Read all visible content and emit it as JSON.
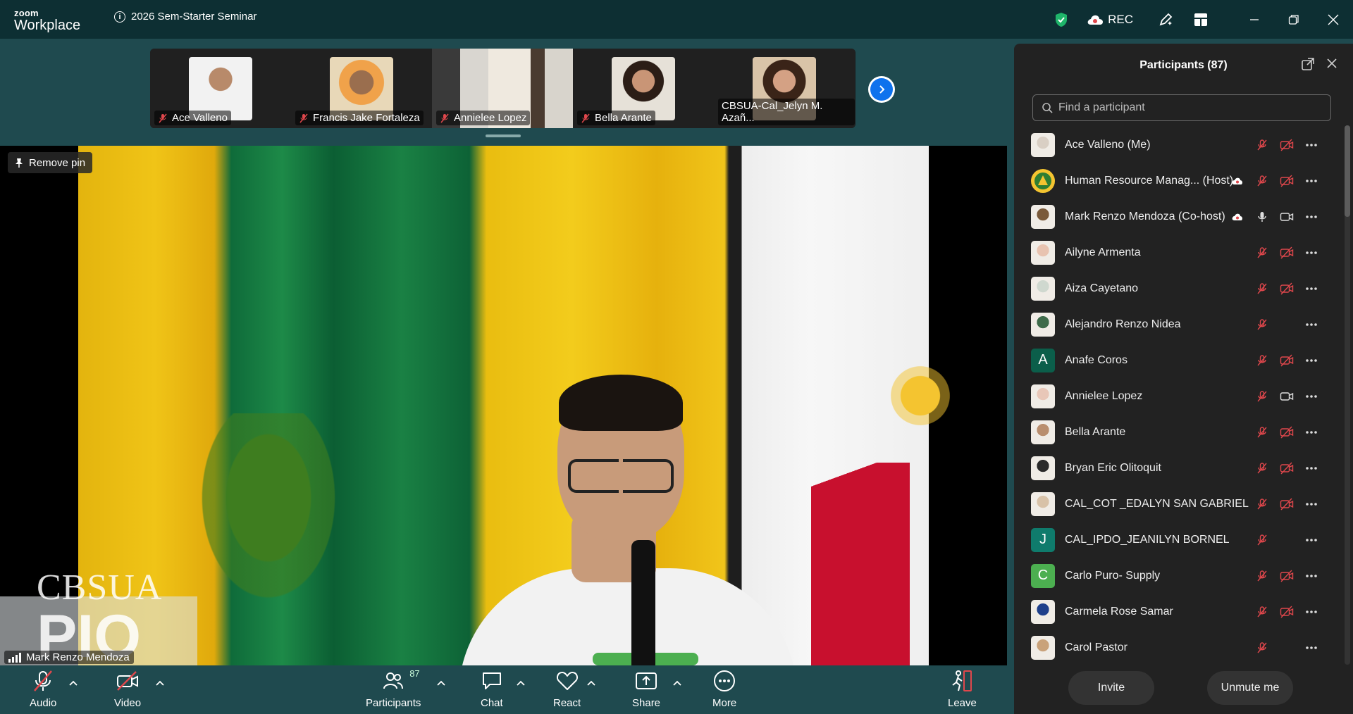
{
  "app": {
    "brand_small": "zoom",
    "brand_large": "Workplace"
  },
  "meeting": {
    "title": "2026 Sem-Starter Seminar"
  },
  "titlebar": {
    "rec_label": "REC"
  },
  "thumbnails": [
    {
      "name": "Ace Valleno"
    },
    {
      "name": "Francis Jake Fortaleza"
    },
    {
      "name": "Annielee Lopez"
    },
    {
      "name": "Bella Arante"
    },
    {
      "name": "CBSUA-Cal_Jelyn M. Azañ..."
    }
  ],
  "main_video": {
    "remove_pin_label": "Remove pin",
    "speaker_name": "Mark Renzo Mendoza",
    "watermark_top": "CBSUA",
    "watermark_bottom": "PIO"
  },
  "toolbar": {
    "audio": "Audio",
    "video": "Video",
    "participants": "Participants",
    "participants_count": "87",
    "chat": "Chat",
    "react": "React",
    "share": "Share",
    "more": "More",
    "leave": "Leave"
  },
  "panel": {
    "title": "Participants (87)",
    "search_placeholder": "Find a participant",
    "invite_label": "Invite",
    "unmute_label": "Unmute me",
    "participants": [
      {
        "name": "Ace Valleno (Me)",
        "avatar": "photo",
        "avatar_color": "#d9cfc4",
        "mic": "muted",
        "video": "off",
        "rec": false
      },
      {
        "name": "Human Resource Manag...  (Host)",
        "avatar": "logo",
        "avatar_color": "#2e7d32",
        "mic": "muted",
        "video": "off",
        "rec": true
      },
      {
        "name": "Mark Renzo Mendoza (Co-host)",
        "avatar": "photo",
        "avatar_color": "#7a5a3a",
        "mic": "on",
        "video": "on",
        "rec": true
      },
      {
        "name": "Ailyne Armenta",
        "avatar": "photo",
        "avatar_color": "#e8c3b0",
        "mic": "muted",
        "video": "off",
        "rec": false
      },
      {
        "name": "Aiza Cayetano",
        "avatar": "photo",
        "avatar_color": "#cfd8cf",
        "mic": "muted",
        "video": "off",
        "rec": false
      },
      {
        "name": "Alejandro Renzo Nidea",
        "avatar": "photo",
        "avatar_color": "#3e6b4a",
        "mic": "muted",
        "video": "none",
        "rec": false
      },
      {
        "name": "Anafe Coros",
        "avatar": "A",
        "avatar_color": "#0b5e4a",
        "mic": "muted",
        "video": "off",
        "rec": false
      },
      {
        "name": "Annielee Lopez",
        "avatar": "photo",
        "avatar_color": "#e8c7b8",
        "mic": "muted",
        "video": "on",
        "rec": false
      },
      {
        "name": "Bella Arante",
        "avatar": "photo",
        "avatar_color": "#b98e6e",
        "mic": "muted",
        "video": "off",
        "rec": false
      },
      {
        "name": "Bryan Eric Olitoquit",
        "avatar": "photo",
        "avatar_color": "#2a2a2a",
        "mic": "muted",
        "video": "off",
        "rec": false
      },
      {
        "name": "CAL_COT _EDALYN SAN GABRIEL",
        "avatar": "photo",
        "avatar_color": "#d8c2a8",
        "mic": "muted",
        "video": "off",
        "rec": false
      },
      {
        "name": "CAL_IPDO_JEANILYN BORNEL",
        "avatar": "J",
        "avatar_color": "#0f7b6c",
        "mic": "muted",
        "video": "none",
        "rec": false
      },
      {
        "name": "Carlo Puro- Supply",
        "avatar": "C",
        "avatar_color": "#4caf50",
        "mic": "muted",
        "video": "off",
        "rec": false
      },
      {
        "name": "Carmela Rose Samar",
        "avatar": "photo",
        "avatar_color": "#1e3f8a",
        "mic": "muted",
        "video": "off",
        "rec": false
      },
      {
        "name": "Carol Pastor",
        "avatar": "photo",
        "avatar_color": "#c9a27a",
        "mic": "muted",
        "video": "none",
        "rec": false
      }
    ]
  },
  "colors": {
    "background": "#1f4a4f",
    "titlebar": "#0d2f33",
    "panel": "#222222",
    "muted_red": "#e0474c",
    "accent_blue": "#0e72ed",
    "shield_green": "#1fb46a"
  }
}
